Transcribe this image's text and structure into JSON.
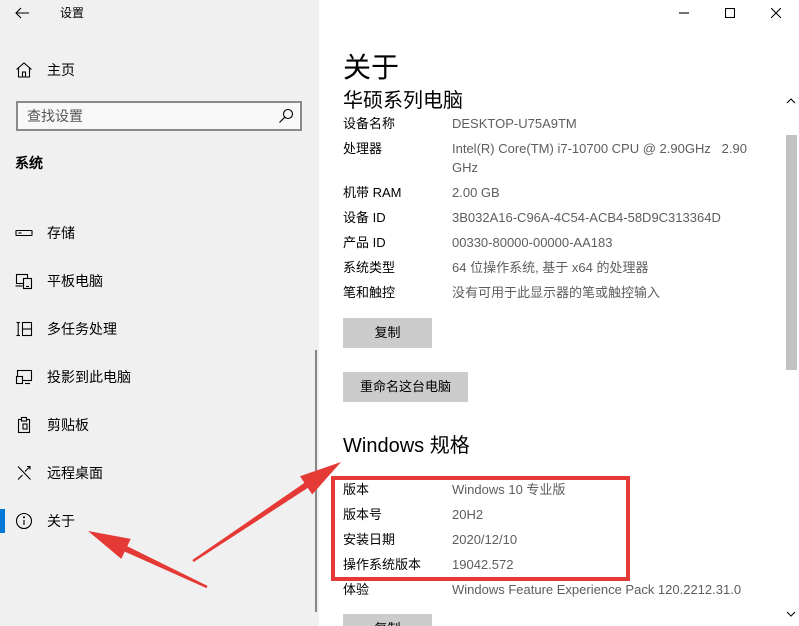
{
  "window": {
    "title": "设置",
    "back_icon": "back-arrow-icon",
    "minimize_icon": "minimize-icon",
    "maximize_icon": "maximize-icon",
    "close_icon": "close-icon"
  },
  "sidebar": {
    "home": {
      "label": "主页",
      "icon": "home-icon"
    },
    "search": {
      "placeholder": "查找设置",
      "icon": "search-icon"
    },
    "section_title": "系统",
    "items": [
      {
        "label": "存储",
        "icon": "storage-icon"
      },
      {
        "label": "平板电脑",
        "icon": "tablet-icon"
      },
      {
        "label": "多任务处理",
        "icon": "multitasking-icon"
      },
      {
        "label": "投影到此电脑",
        "icon": "project-icon"
      },
      {
        "label": "剪贴板",
        "icon": "clipboard-icon"
      },
      {
        "label": "远程桌面",
        "icon": "remote-desktop-icon"
      },
      {
        "label": "关于",
        "icon": "info-icon",
        "selected": true
      }
    ]
  },
  "main": {
    "page_title": "关于",
    "device": {
      "heading": "华硕系列电脑",
      "specs": [
        {
          "label": "设备名称",
          "value": "DESKTOP-U75A9TM"
        },
        {
          "label": "处理器",
          "value": "Intel(R) Core(TM) i7-10700 CPU @ 2.90GHz   2.90 GHz"
        },
        {
          "label": "机带 RAM",
          "value": "2.00 GB"
        },
        {
          "label": "设备 ID",
          "value": "3B032A16-C96A-4C54-ACB4-58D9C313364D"
        },
        {
          "label": "产品 ID",
          "value": "00330-80000-00000-AA183"
        },
        {
          "label": "系统类型",
          "value": "64 位操作系统, 基于 x64 的处理器"
        },
        {
          "label": "笔和触控",
          "value": "没有可用于此显示器的笔或触控输入"
        }
      ],
      "copy_button": "复制",
      "rename_button": "重命名这台电脑"
    },
    "windows": {
      "heading": "Windows 规格",
      "specs": [
        {
          "label": "版本",
          "value": "Windows 10 专业版"
        },
        {
          "label": "版本号",
          "value": "20H2"
        },
        {
          "label": "安装日期",
          "value": "2020/12/10"
        },
        {
          "label": "操作系统版本",
          "value": "19042.572"
        },
        {
          "label": "体验",
          "value": "Windows Feature Experience Pack 120.2212.31.0"
        }
      ],
      "copy_button": "复制"
    }
  },
  "colors": {
    "sidebar_bg": "#f0f0f0",
    "accent": "#0078d7",
    "button_bg": "#cccccc",
    "value_text": "#5d5d5d",
    "annotation": "#e53935",
    "scroll_thumb": "#c2c2c2"
  }
}
